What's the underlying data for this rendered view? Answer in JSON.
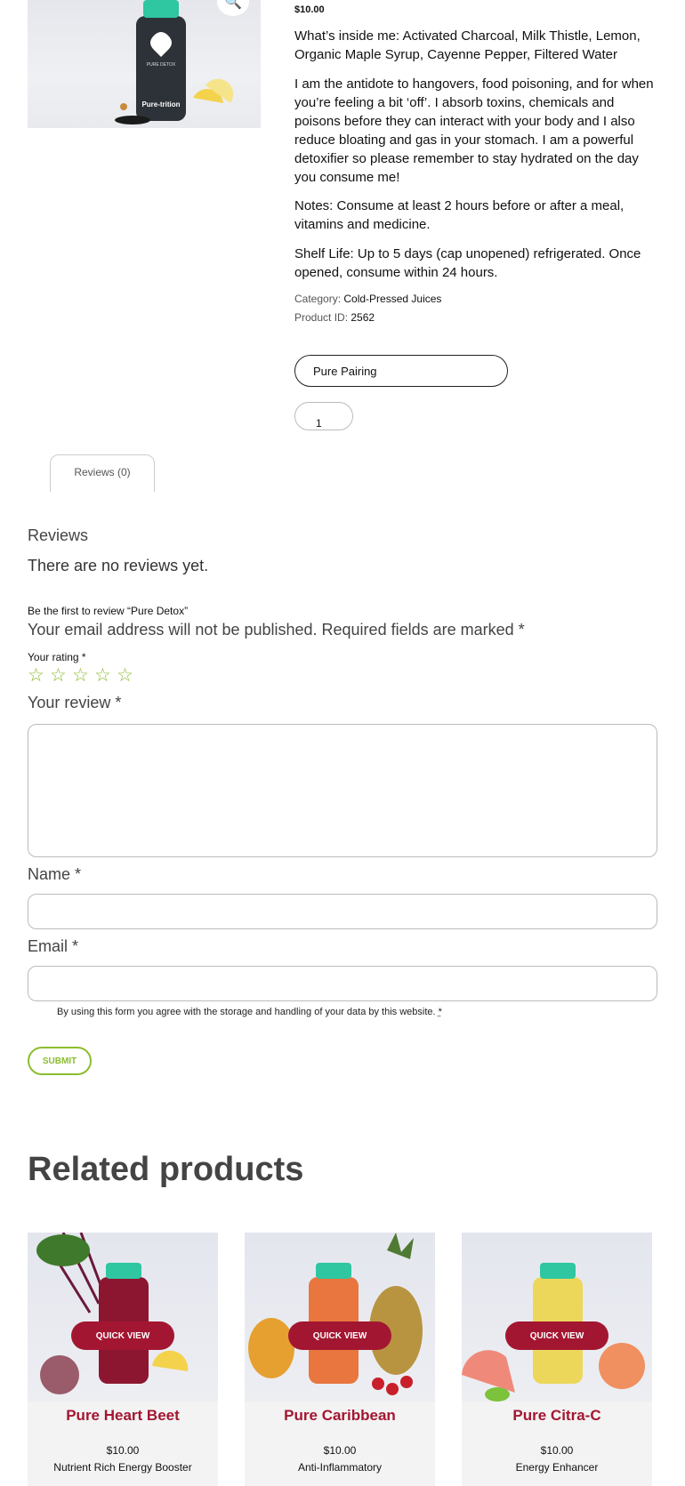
{
  "product": {
    "price": "$10.00",
    "ingredients": "What’s inside me: Activated Charcoal, Milk Thistle, Lemon, Organic Maple Syrup, Cayenne Pepper, Filtered Water",
    "description": "I am the antidote to hangovers, food poisoning, and for when you’re feeling a bit ‘off’. I absorb toxins, chemicals and poisons before they can interact with your body and I also reduce bloating and gas in your stomach. I am a powerful detoxifier so please remember to stay hydrated on the day you consume me!",
    "notes": "Notes: Consume at least 2 hours before or after a meal, vitamins and medicine.",
    "shelf_life": "Shelf Life: Up to 5 days (cap unopened) refrigerated. Once opened, consume within 24 hours.",
    "category_label": "Category:",
    "category": "Cold-Pressed Juices",
    "id_label": "Product ID:",
    "id": "2562",
    "pairing_selected": "Pure Pairing",
    "quantity": "1",
    "bottle_label": "PURE DETOX",
    "brand": "Pure-trition"
  },
  "tabs": {
    "reviews_tab": "Reviews (0)"
  },
  "reviews": {
    "heading": "Reviews",
    "empty": "There are no reviews yet.",
    "first_review": "Be the first to review “Pure Detox”",
    "notice": "Your email address will not be published. Required fields are marked *",
    "rating_label": "Your rating *",
    "review_label": "Your review *",
    "name_label": "Name *",
    "email_label": "Email *",
    "consent": "By using this form you agree with the storage and handling of your data by this website.",
    "consent_req": "*",
    "submit": "SUBMIT"
  },
  "related": {
    "heading": "Related products",
    "quick_view": "QUICK VIEW",
    "items": [
      {
        "name": "Pure Heart Beet",
        "price": "$10.00",
        "subtitle": "Nutrient Rich Energy Booster"
      },
      {
        "name": "Pure Caribbean",
        "price": "$10.00",
        "subtitle": "Anti-Inflammatory"
      },
      {
        "name": "Pure Citra-C",
        "price": "$10.00",
        "subtitle": "Energy Enhancer"
      }
    ]
  },
  "colors": {
    "accent_green": "#8cbd2e",
    "brand_red": "#a31631"
  }
}
